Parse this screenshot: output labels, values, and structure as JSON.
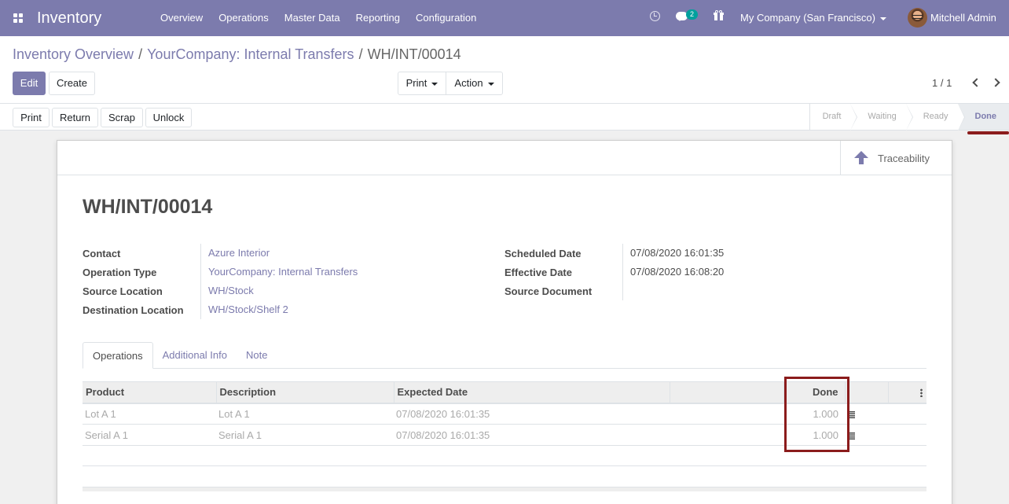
{
  "navbar": {
    "app_name": "Inventory",
    "menu": [
      "Overview",
      "Operations",
      "Master Data",
      "Reporting",
      "Configuration"
    ],
    "chat_badge": "2",
    "company": "My Company (San Francisco)",
    "user": "Mitchell Admin",
    "brand_color": "#7c7bad"
  },
  "breadcrumb": {
    "items": [
      "Inventory Overview",
      "YourCompany: Internal Transfers"
    ],
    "current": "WH/INT/00014"
  },
  "toolbar": {
    "edit": "Edit",
    "create": "Create",
    "print": "Print",
    "action": "Action",
    "pager": "1 / 1"
  },
  "statusbar": {
    "buttons": [
      "Print",
      "Return",
      "Scrap",
      "Unlock"
    ],
    "stages": [
      "Draft",
      "Waiting",
      "Ready",
      "Done"
    ],
    "active_stage": "Done"
  },
  "smart_button": {
    "label": "Traceability"
  },
  "record": {
    "name": "WH/INT/00014",
    "left_fields": [
      {
        "label": "Contact",
        "value": "Azure Interior"
      },
      {
        "label": "Operation Type",
        "value": "YourCompany: Internal Transfers"
      },
      {
        "label": "Source Location",
        "value": "WH/Stock"
      },
      {
        "label": "Destination Location",
        "value": "WH/Stock/Shelf 2"
      }
    ],
    "right_fields": [
      {
        "label": "Scheduled Date",
        "value": "07/08/2020 16:01:35"
      },
      {
        "label": "Effective Date",
        "value": "07/08/2020 16:08:20"
      },
      {
        "label": "Source Document",
        "value": ""
      }
    ]
  },
  "tabs": [
    "Operations",
    "Additional Info",
    "Note"
  ],
  "table": {
    "headers": [
      "Product",
      "Description",
      "Expected Date",
      "",
      "Done"
    ],
    "rows": [
      {
        "product": "Lot A 1",
        "description": "Lot A 1",
        "expected_date": "07/08/2020 16:01:35",
        "done": "1.000"
      },
      {
        "product": "Serial A 1",
        "description": "Serial A 1",
        "expected_date": "07/08/2020 16:01:35",
        "done": "1.000"
      }
    ]
  }
}
